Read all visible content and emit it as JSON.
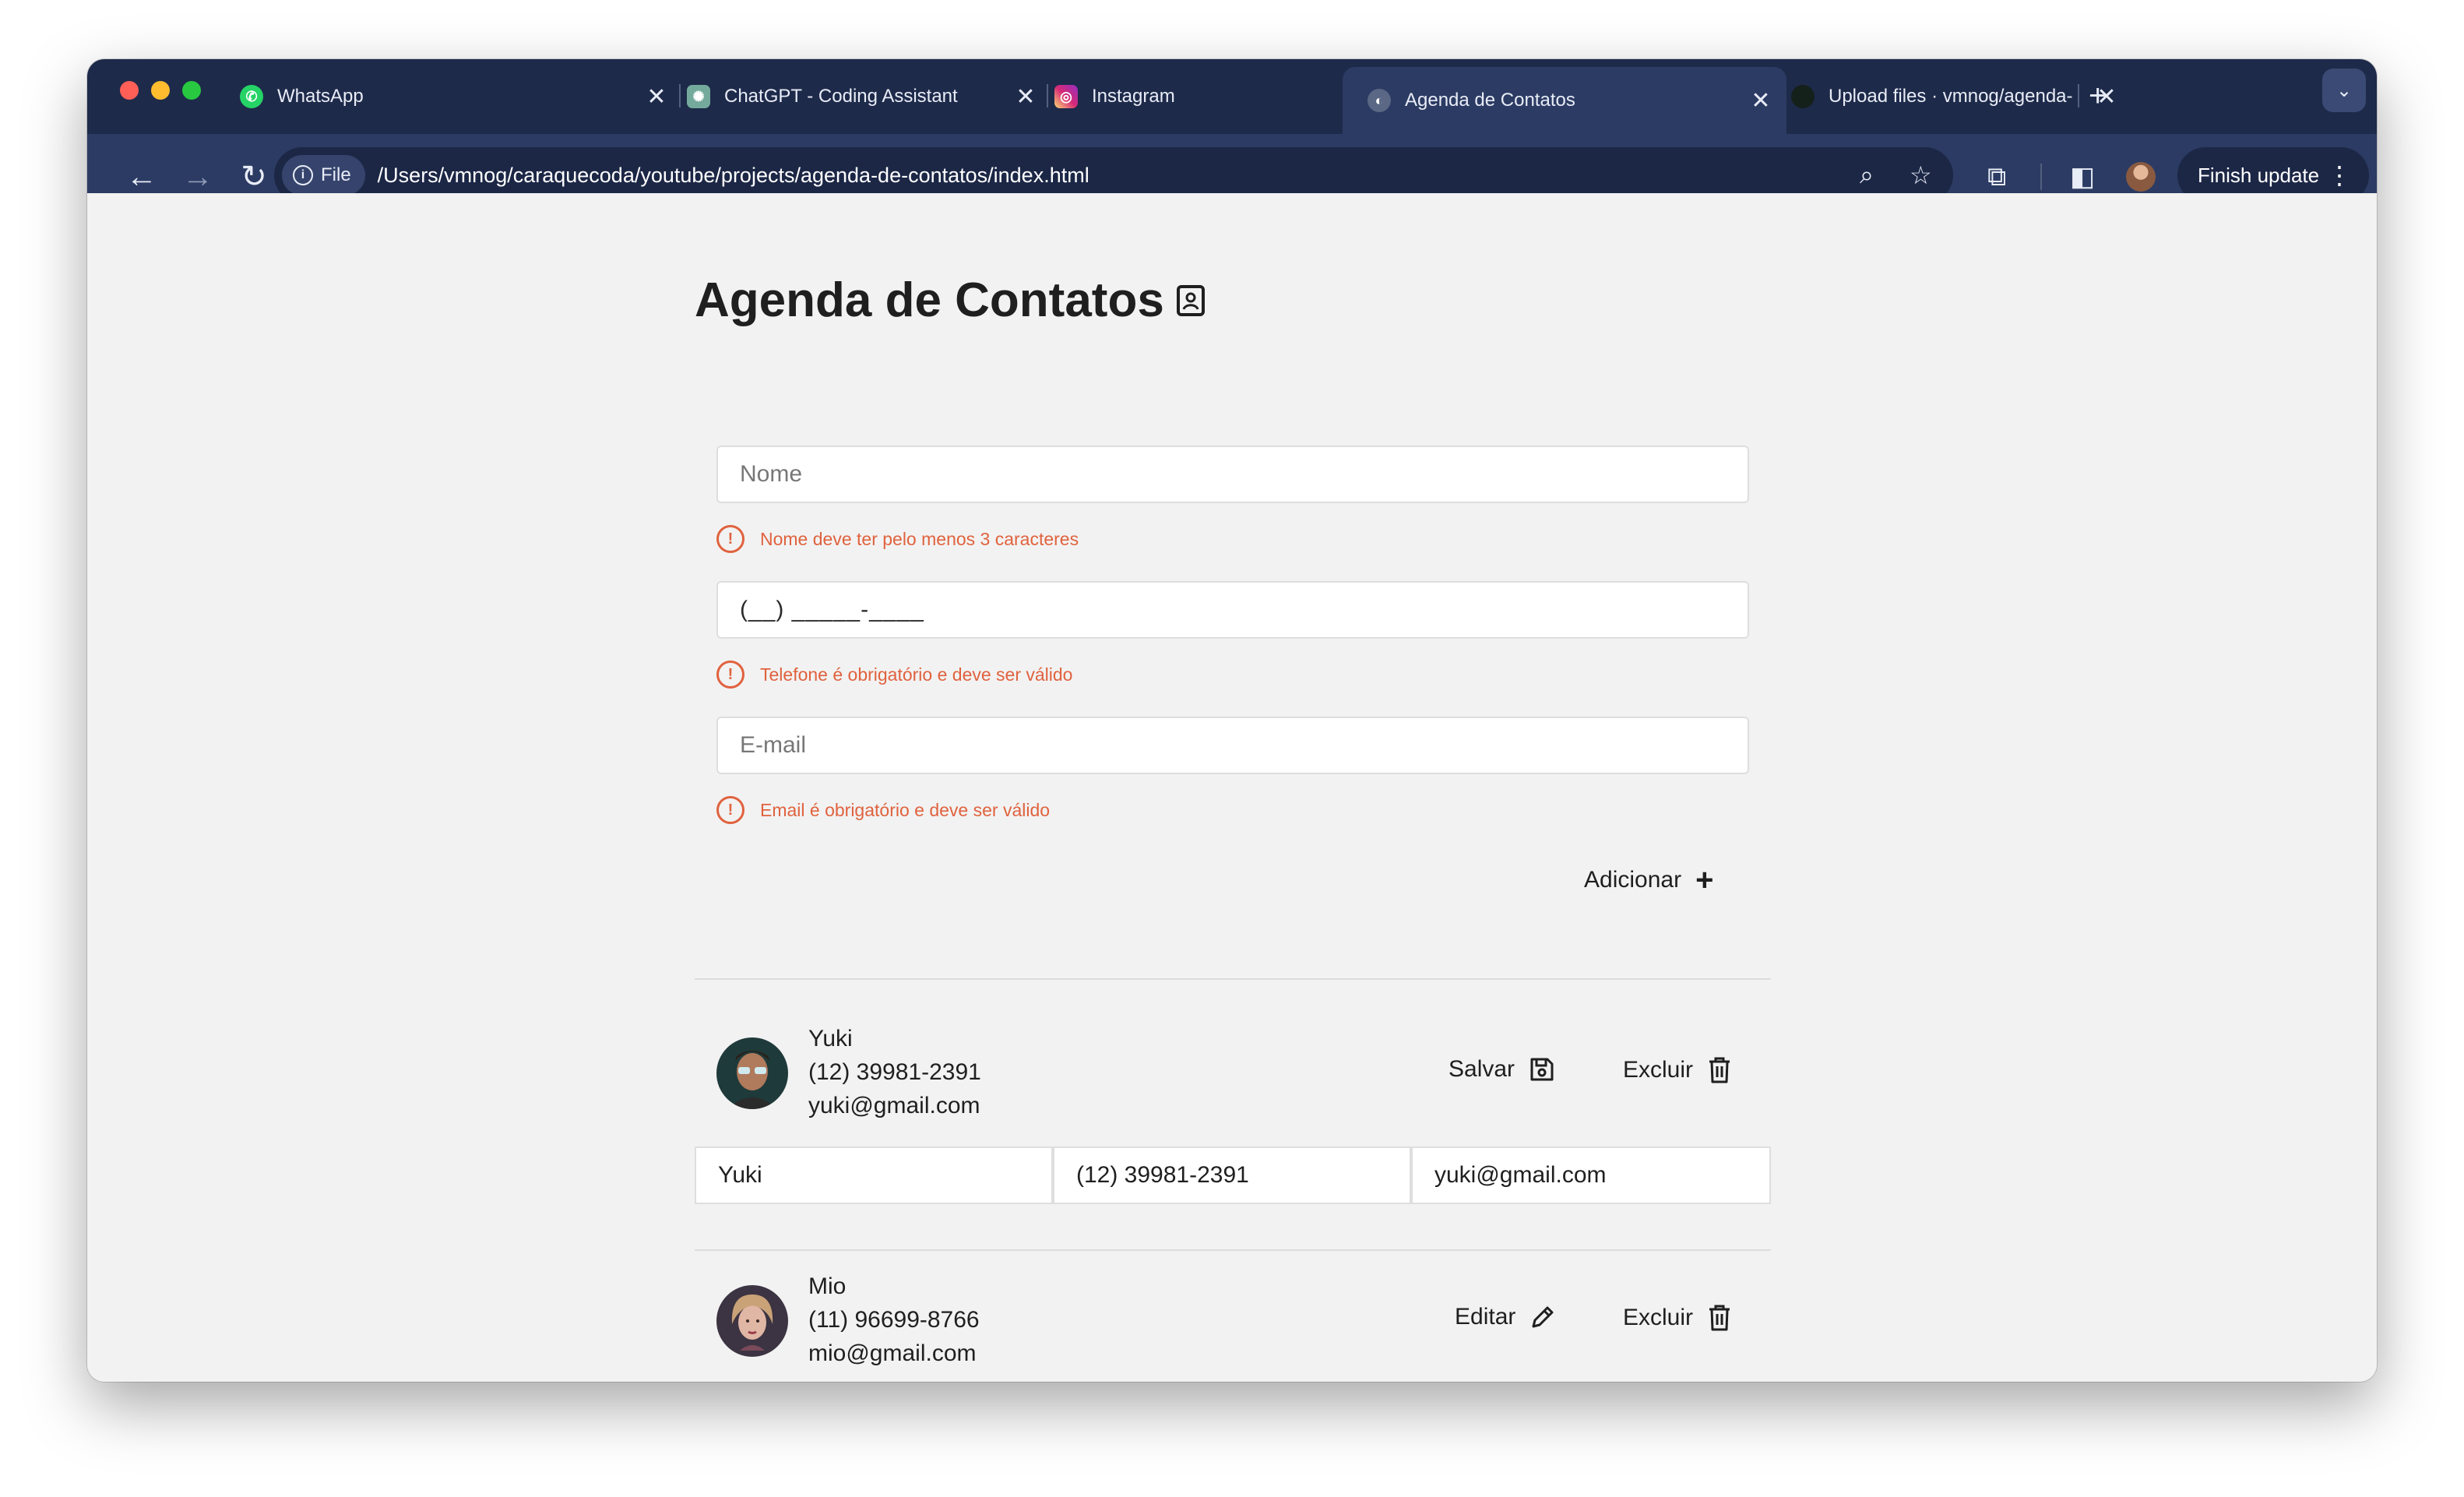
{
  "browser": {
    "tabs": [
      {
        "title": "WhatsApp",
        "icon": "whatsapp-icon"
      },
      {
        "title": "ChatGPT - Coding Assistant",
        "icon": "chatgpt-icon"
      },
      {
        "title": "Instagram",
        "icon": "instagram-icon"
      },
      {
        "title": "Agenda de Contatos",
        "icon": "globe-icon",
        "active": true
      },
      {
        "title": "Upload files · vmnog/agenda-",
        "icon": "github-icon"
      }
    ],
    "close_glyph": "✕",
    "new_tab_glyph": "+",
    "chip_label": "File",
    "url": "/Users/vmnog/caraquecoda/youtube/projects/agenda-de-contatos/index.html",
    "finish_update_label": "Finish update"
  },
  "app": {
    "title": "Agenda de Contatos",
    "form": {
      "name_placeholder": "Nome",
      "name_error": "Nome deve ter pelo menos 3 caracteres",
      "phone_value": "(__) _____-____",
      "phone_error": "Telefone é obrigatório e deve ser válido",
      "email_placeholder": "E-mail",
      "email_error": "Email é obrigatório e deve ser válido",
      "add_label": "Adicionar"
    },
    "contacts": [
      {
        "name": "Yuki",
        "phone": "(12) 39981-2391",
        "email": "yuki@gmail.com",
        "primary_action": "Salvar",
        "primary_icon": "save-icon",
        "delete_label": "Excluir",
        "editing": true,
        "edit_values": {
          "name": "Yuki",
          "phone": "(12) 39981-2391",
          "email": "yuki@gmail.com"
        }
      },
      {
        "name": "Mio",
        "phone": "(11) 96699-8766",
        "email": "mio@gmail.com",
        "primary_action": "Editar",
        "primary_icon": "pencil-icon",
        "delete_label": "Excluir",
        "editing": false
      }
    ]
  },
  "colors": {
    "tab_strip": "#1e2a4a",
    "toolbar": "#2c3b63",
    "page_bg": "#f2f2f2",
    "error": "#e0623e"
  }
}
